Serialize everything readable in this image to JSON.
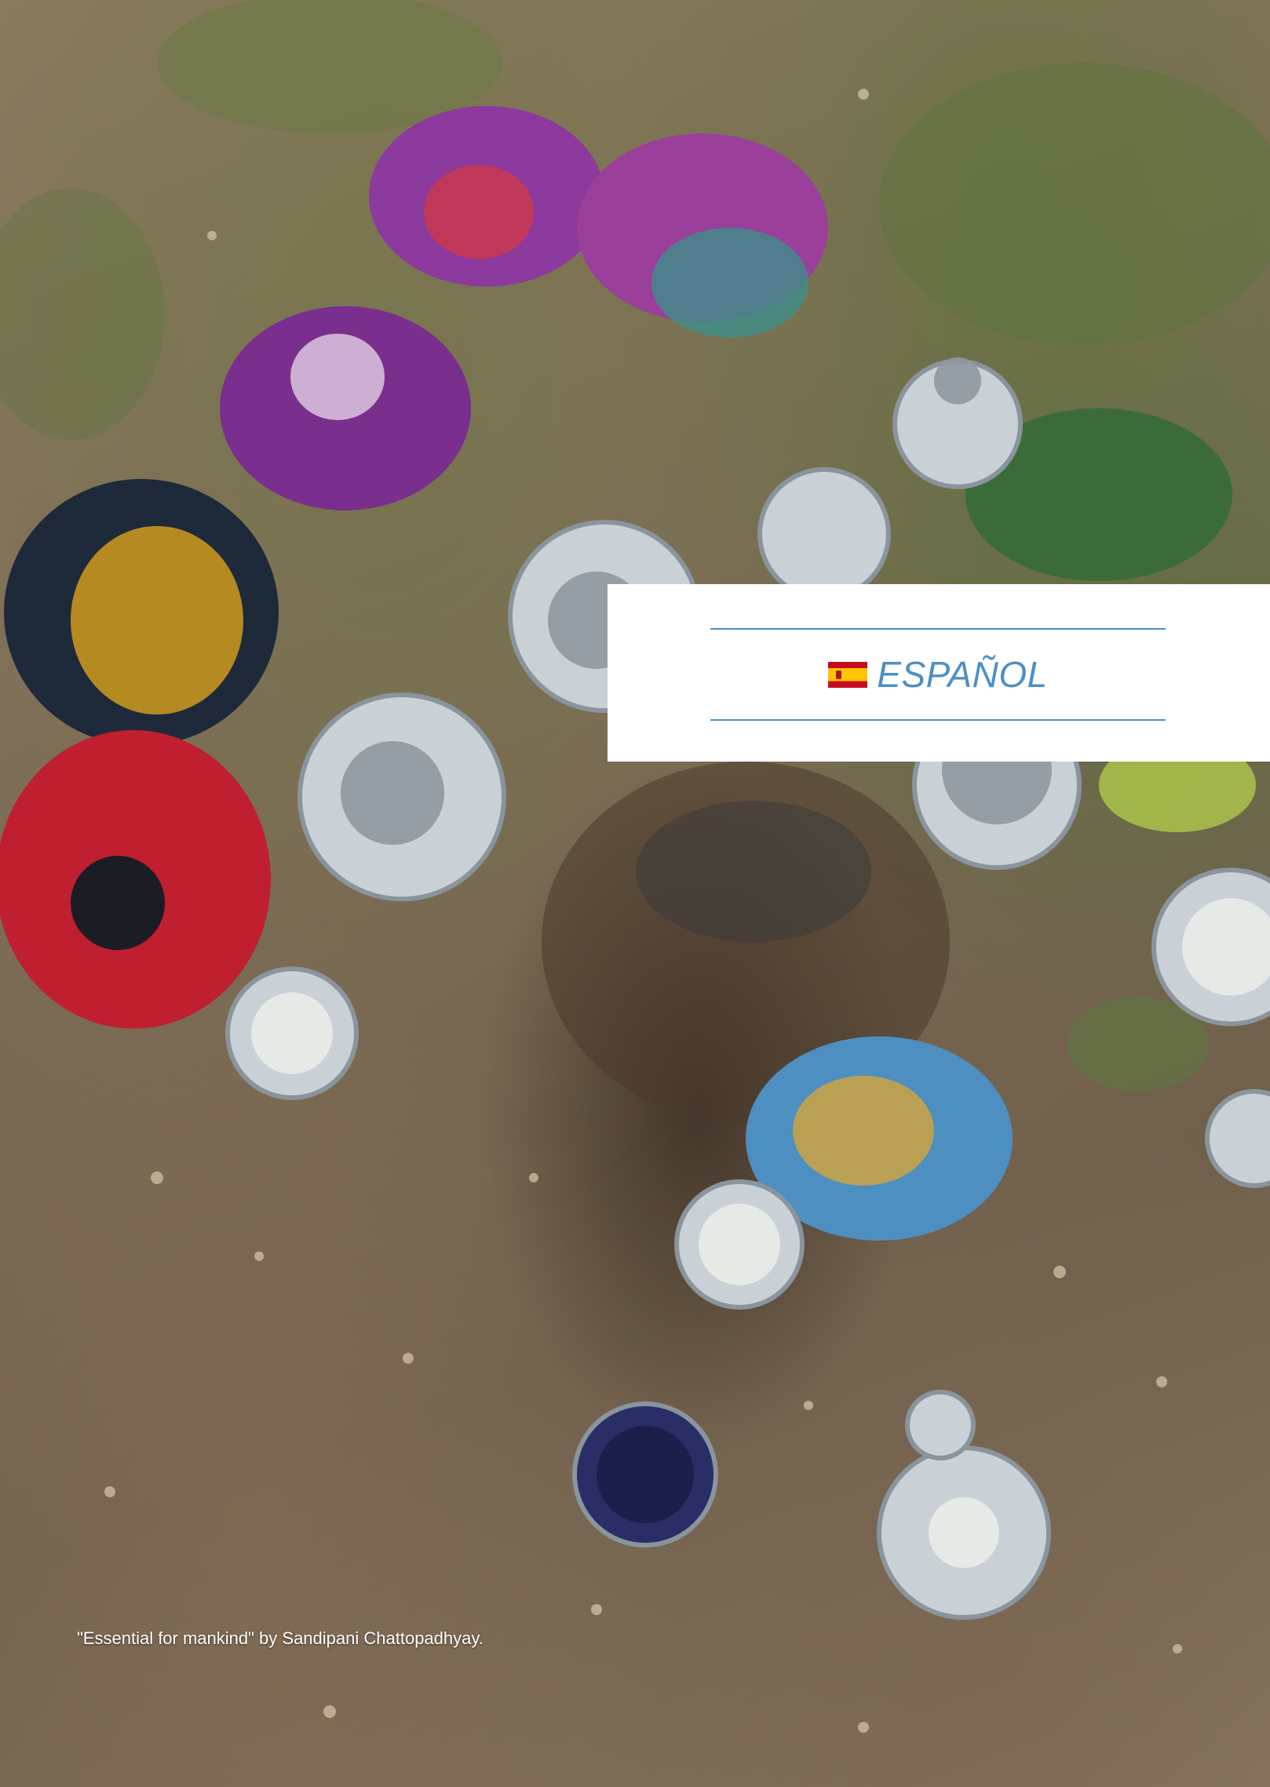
{
  "language": {
    "label": "ESPAÑOL",
    "flag_icon": "spain-flag-icon",
    "accent_color": "#4a90c8"
  },
  "photo": {
    "caption": "\"Essential for mankind\" by Sandipani Chattopadhyay."
  }
}
